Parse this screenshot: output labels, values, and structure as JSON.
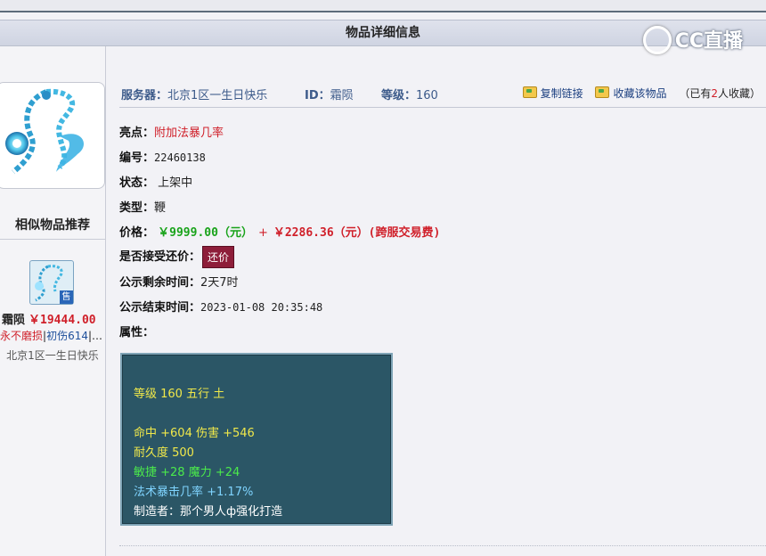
{
  "header": {
    "title": "物品详细信息",
    "watermark": "CC直播"
  },
  "left_panel": {
    "similar_title": "相似物品推荐",
    "similar_item": {
      "badge": "售",
      "name": "霜陨",
      "price": "￥19444.00",
      "tag_red": "永不磨损",
      "sep1": "|",
      "tag_blue": "初伤614",
      "sep2": "|…",
      "server": "北京1区一生日快乐"
    }
  },
  "info": {
    "server_label": "服务器：",
    "server_value": "北京1区一生日快乐",
    "id_label": "ID：",
    "id_value": "霜陨",
    "level_label": "等级：",
    "level_value": "160",
    "copy_link": "复制链接",
    "favorite": "收藏该物品",
    "fav_prefix": "（已有",
    "fav_count": "2",
    "fav_suffix": "人收藏）"
  },
  "details": {
    "highlight_label": "亮点：",
    "highlight_value": "附加法暴几率",
    "number_label": "编号：",
    "number_value": "22460138",
    "status_label": "状态：",
    "status_value": "上架中",
    "type_label": "类型：",
    "type_value": "鞭",
    "price_label": "价格：",
    "price_value": "￥9999.00（元）",
    "plus": "+",
    "fee_value": "￥2286.36（元）(跨服交易费)",
    "counter_label": "是否接受还价：",
    "counter_button": "还价",
    "remain_label": "公示剩余时间：",
    "remain_value": "2天7时",
    "end_label": "公示结束时间：",
    "end_value": "2023-01-08 20:35:48",
    "attr_label": "属性："
  },
  "attributes": {
    "line1": "等级 160 五行 土",
    "line2": "命中 +604 伤害 +546",
    "line3": "耐久度 500",
    "line4": "敏捷 +28 魔力 +24",
    "line5": "法术暴击几率 +1.17%",
    "line6": "制造者：那个男人ф强化打造"
  },
  "colors": {
    "attr_bg": "#2b5666",
    "price_green": "#19a31a",
    "accent_red": "#d0202a",
    "counter_button": "#8e1e3a",
    "label_blue": "#3c5a8a"
  }
}
